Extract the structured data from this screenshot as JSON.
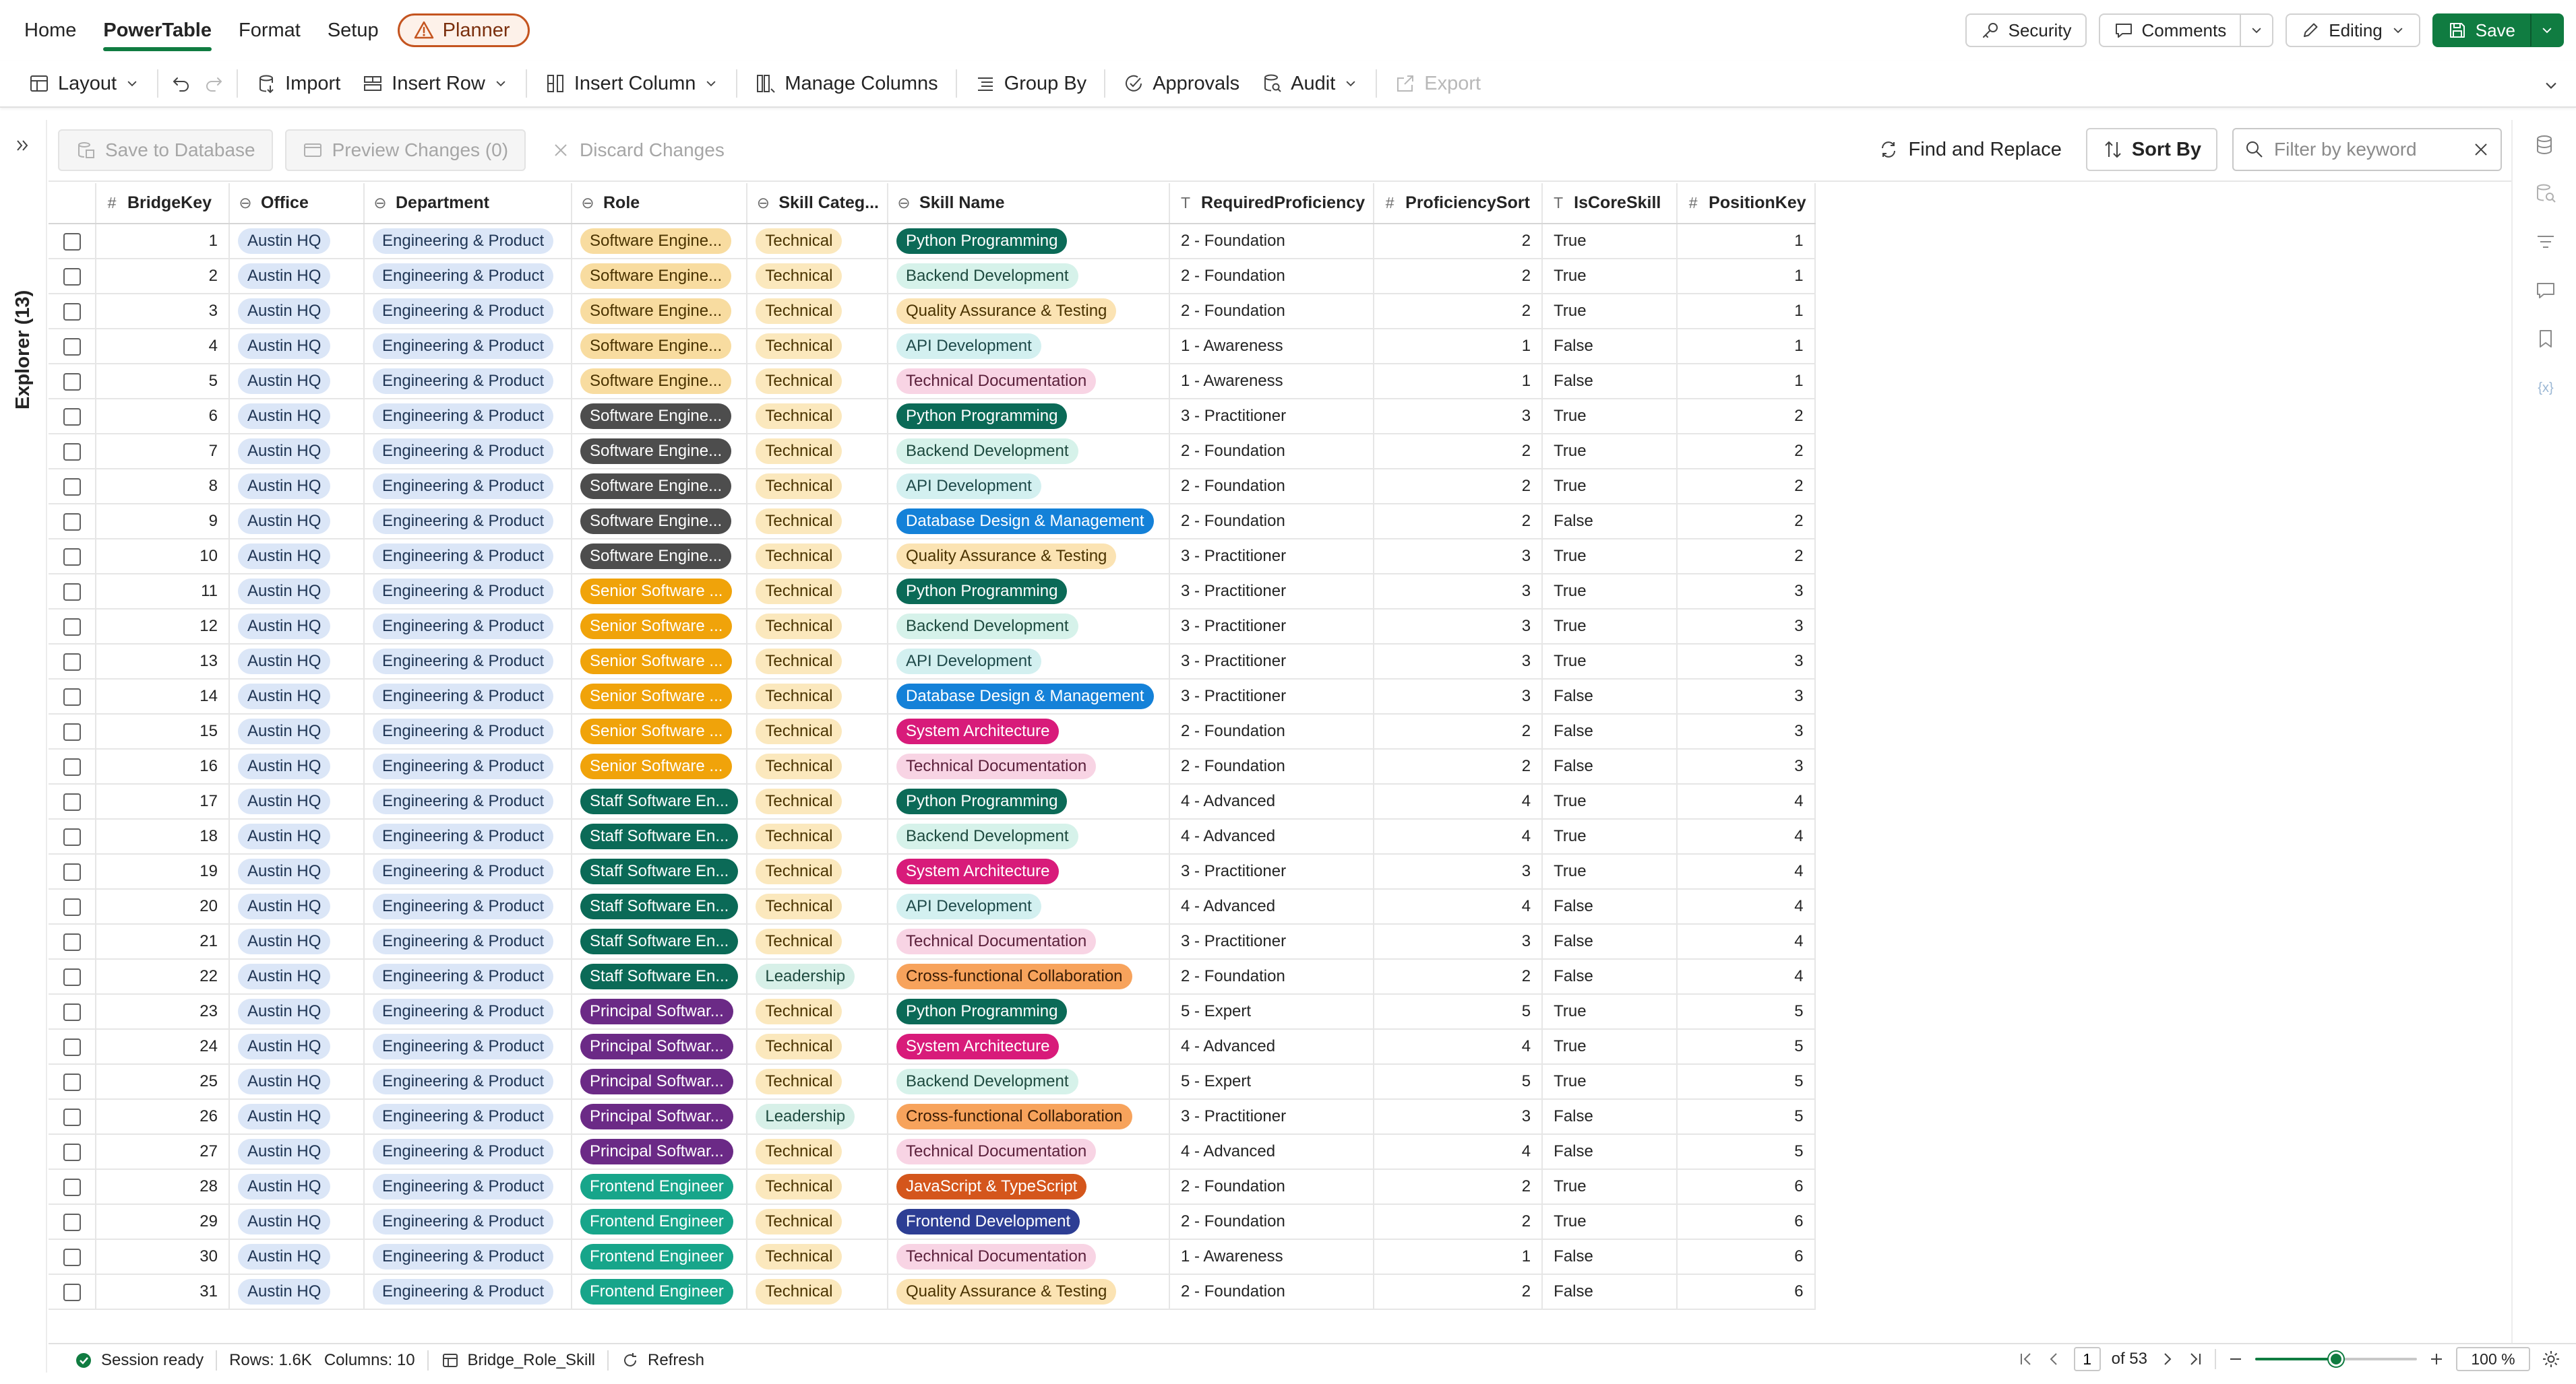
{
  "menu": {
    "tabs": [
      {
        "label": "Home",
        "active": false
      },
      {
        "label": "PowerTable",
        "active": true
      },
      {
        "label": "Format",
        "active": false
      },
      {
        "label": "Setup",
        "active": false
      }
    ],
    "planner_label": "Planner",
    "security_label": "Security",
    "comments_label": "Comments",
    "editing_label": "Editing",
    "save_label": "Save"
  },
  "ribbon": {
    "layout": "Layout",
    "import": "Import",
    "insert_row": "Insert Row",
    "insert_column": "Insert Column",
    "manage_columns": "Manage Columns",
    "group_by": "Group By",
    "approvals": "Approvals",
    "audit": "Audit",
    "export": "Export"
  },
  "explorer": {
    "label": "Explorer (13)"
  },
  "actions": {
    "save_db": "Save to Database",
    "preview": "Preview Changes (0)",
    "discard": "Discard Changes",
    "find_replace": "Find and Replace",
    "sort_by": "Sort By",
    "filter_placeholder": "Filter by keyword"
  },
  "colors": {
    "brand_green": "#107c41",
    "planner_border": "#c4541f"
  },
  "table": {
    "columns": [
      {
        "label": "BridgeKey",
        "icon": "#"
      },
      {
        "label": "Office",
        "icon": "⊖"
      },
      {
        "label": "Department",
        "icon": "⊖"
      },
      {
        "label": "Role",
        "icon": "⊖"
      },
      {
        "label": "Skill Categ...",
        "icon": "⊖"
      },
      {
        "label": "Skill Name",
        "icon": "⊖"
      },
      {
        "label": "RequiredProficiency",
        "icon": "T"
      },
      {
        "label": "ProficiencySort",
        "icon": "#"
      },
      {
        "label": "IsCoreSkill",
        "icon": "T"
      },
      {
        "label": "PositionKey",
        "icon": "#"
      }
    ],
    "role_styles": {
      "Software Engine...": {
        "bg": "#f8dca0",
        "fg": "#4a3300"
      },
      "Software Engine...|2": {
        "bg": "#4d4d4d",
        "fg": "#ffffff"
      },
      "Senior Software ...": {
        "bg": "#f0a30a",
        "fg": "#ffffff"
      },
      "Staff Software En...": {
        "bg": "#0b6a57",
        "fg": "#ffffff"
      },
      "Principal Softwar...": {
        "bg": "#6b2a86",
        "fg": "#ffffff"
      },
      "Frontend Engineer": {
        "bg": "#17a58a",
        "fg": "#ffffff"
      }
    },
    "category_styles": {
      "Technical": {
        "bg": "#fbe8bd",
        "fg": "#4a3300"
      },
      "Leadership": {
        "bg": "#d7f0e8",
        "fg": "#1e4a3f"
      }
    },
    "skill_styles": {
      "Python Programming": {
        "bg": "#0b6a57",
        "fg": "#ffffff"
      },
      "Backend Development": {
        "bg": "#d6f2ea",
        "fg": "#1e4a3f"
      },
      "Quality Assurance & Testing": {
        "bg": "#fbe3b3",
        "fg": "#4a3300"
      },
      "API Development": {
        "bg": "#d3f0f0",
        "fg": "#1f4a4a"
      },
      "Technical Documentation": {
        "bg": "#f8d4e4",
        "fg": "#5a1f3a"
      },
      "Database Design & Management": {
        "bg": "#1481d8",
        "fg": "#ffffff"
      },
      "System Architecture": {
        "bg": "#d81b7a",
        "fg": "#ffffff"
      },
      "Cross-functional Collaboration": {
        "bg": "#f7a35c",
        "fg": "#3b1d05"
      },
      "JavaScript & TypeScript": {
        "bg": "#d4561c",
        "fg": "#ffffff"
      },
      "Frontend Development": {
        "bg": "#2d3e94",
        "fg": "#ffffff"
      }
    },
    "rows": [
      {
        "key": "1",
        "office": "Austin HQ",
        "dept": "Engineering & Product",
        "role": "Software Engine...",
        "role_style": "Software Engine...",
        "cat": "Technical",
        "skill": "Python Programming",
        "prof": "2 - Foundation",
        "sort": "2",
        "core": "True",
        "pos": "1"
      },
      {
        "key": "2",
        "office": "Austin HQ",
        "dept": "Engineering & Product",
        "role": "Software Engine...",
        "role_style": "Software Engine...",
        "cat": "Technical",
        "skill": "Backend Development",
        "prof": "2 - Foundation",
        "sort": "2",
        "core": "True",
        "pos": "1"
      },
      {
        "key": "3",
        "office": "Austin HQ",
        "dept": "Engineering & Product",
        "role": "Software Engine...",
        "role_style": "Software Engine...",
        "cat": "Technical",
        "skill": "Quality Assurance & Testing",
        "prof": "2 - Foundation",
        "sort": "2",
        "core": "True",
        "pos": "1"
      },
      {
        "key": "4",
        "office": "Austin HQ",
        "dept": "Engineering & Product",
        "role": "Software Engine...",
        "role_style": "Software Engine...",
        "cat": "Technical",
        "skill": "API Development",
        "prof": "1 - Awareness",
        "sort": "1",
        "core": "False",
        "pos": "1"
      },
      {
        "key": "5",
        "office": "Austin HQ",
        "dept": "Engineering & Product",
        "role": "Software Engine...",
        "role_style": "Software Engine...",
        "cat": "Technical",
        "skill": "Technical Documentation",
        "prof": "1 - Awareness",
        "sort": "1",
        "core": "False",
        "pos": "1"
      },
      {
        "key": "6",
        "office": "Austin HQ",
        "dept": "Engineering & Product",
        "role": "Software Engine...",
        "role_style": "Software Engine...|2",
        "cat": "Technical",
        "skill": "Python Programming",
        "prof": "3 - Practitioner",
        "sort": "3",
        "core": "True",
        "pos": "2"
      },
      {
        "key": "7",
        "office": "Austin HQ",
        "dept": "Engineering & Product",
        "role": "Software Engine...",
        "role_style": "Software Engine...|2",
        "cat": "Technical",
        "skill": "Backend Development",
        "prof": "2 - Foundation",
        "sort": "2",
        "core": "True",
        "pos": "2"
      },
      {
        "key": "8",
        "office": "Austin HQ",
        "dept": "Engineering & Product",
        "role": "Software Engine...",
        "role_style": "Software Engine...|2",
        "cat": "Technical",
        "skill": "API Development",
        "prof": "2 - Foundation",
        "sort": "2",
        "core": "True",
        "pos": "2"
      },
      {
        "key": "9",
        "office": "Austin HQ",
        "dept": "Engineering & Product",
        "role": "Software Engine...",
        "role_style": "Software Engine...|2",
        "cat": "Technical",
        "skill": "Database Design & Management",
        "prof": "2 - Foundation",
        "sort": "2",
        "core": "False",
        "pos": "2"
      },
      {
        "key": "10",
        "office": "Austin HQ",
        "dept": "Engineering & Product",
        "role": "Software Engine...",
        "role_style": "Software Engine...|2",
        "cat": "Technical",
        "skill": "Quality Assurance & Testing",
        "prof": "3 - Practitioner",
        "sort": "3",
        "core": "True",
        "pos": "2"
      },
      {
        "key": "11",
        "office": "Austin HQ",
        "dept": "Engineering & Product",
        "role": "Senior Software ...",
        "role_style": "Senior Software ...",
        "cat": "Technical",
        "skill": "Python Programming",
        "prof": "3 - Practitioner",
        "sort": "3",
        "core": "True",
        "pos": "3"
      },
      {
        "key": "12",
        "office": "Austin HQ",
        "dept": "Engineering & Product",
        "role": "Senior Software ...",
        "role_style": "Senior Software ...",
        "cat": "Technical",
        "skill": "Backend Development",
        "prof": "3 - Practitioner",
        "sort": "3",
        "core": "True",
        "pos": "3"
      },
      {
        "key": "13",
        "office": "Austin HQ",
        "dept": "Engineering & Product",
        "role": "Senior Software ...",
        "role_style": "Senior Software ...",
        "cat": "Technical",
        "skill": "API Development",
        "prof": "3 - Practitioner",
        "sort": "3",
        "core": "True",
        "pos": "3"
      },
      {
        "key": "14",
        "office": "Austin HQ",
        "dept": "Engineering & Product",
        "role": "Senior Software ...",
        "role_style": "Senior Software ...",
        "cat": "Technical",
        "skill": "Database Design & Management",
        "prof": "3 - Practitioner",
        "sort": "3",
        "core": "False",
        "pos": "3"
      },
      {
        "key": "15",
        "office": "Austin HQ",
        "dept": "Engineering & Product",
        "role": "Senior Software ...",
        "role_style": "Senior Software ...",
        "cat": "Technical",
        "skill": "System Architecture",
        "prof": "2 - Foundation",
        "sort": "2",
        "core": "False",
        "pos": "3"
      },
      {
        "key": "16",
        "office": "Austin HQ",
        "dept": "Engineering & Product",
        "role": "Senior Software ...",
        "role_style": "Senior Software ...",
        "cat": "Technical",
        "skill": "Technical Documentation",
        "prof": "2 - Foundation",
        "sort": "2",
        "core": "False",
        "pos": "3"
      },
      {
        "key": "17",
        "office": "Austin HQ",
        "dept": "Engineering & Product",
        "role": "Staff Software En...",
        "role_style": "Staff Software En...",
        "cat": "Technical",
        "skill": "Python Programming",
        "prof": "4 - Advanced",
        "sort": "4",
        "core": "True",
        "pos": "4"
      },
      {
        "key": "18",
        "office": "Austin HQ",
        "dept": "Engineering & Product",
        "role": "Staff Software En...",
        "role_style": "Staff Software En...",
        "cat": "Technical",
        "skill": "Backend Development",
        "prof": "4 - Advanced",
        "sort": "4",
        "core": "True",
        "pos": "4"
      },
      {
        "key": "19",
        "office": "Austin HQ",
        "dept": "Engineering & Product",
        "role": "Staff Software En...",
        "role_style": "Staff Software En...",
        "cat": "Technical",
        "skill": "System Architecture",
        "prof": "3 - Practitioner",
        "sort": "3",
        "core": "True",
        "pos": "4"
      },
      {
        "key": "20",
        "office": "Austin HQ",
        "dept": "Engineering & Product",
        "role": "Staff Software En...",
        "role_style": "Staff Software En...",
        "cat": "Technical",
        "skill": "API Development",
        "prof": "4 - Advanced",
        "sort": "4",
        "core": "False",
        "pos": "4"
      },
      {
        "key": "21",
        "office": "Austin HQ",
        "dept": "Engineering & Product",
        "role": "Staff Software En...",
        "role_style": "Staff Software En...",
        "cat": "Technical",
        "skill": "Technical Documentation",
        "prof": "3 - Practitioner",
        "sort": "3",
        "core": "False",
        "pos": "4"
      },
      {
        "key": "22",
        "office": "Austin HQ",
        "dept": "Engineering & Product",
        "role": "Staff Software En...",
        "role_style": "Staff Software En...",
        "cat": "Leadership",
        "skill": "Cross-functional Collaboration",
        "prof": "2 - Foundation",
        "sort": "2",
        "core": "False",
        "pos": "4"
      },
      {
        "key": "23",
        "office": "Austin HQ",
        "dept": "Engineering & Product",
        "role": "Principal Softwar...",
        "role_style": "Principal Softwar...",
        "cat": "Technical",
        "skill": "Python Programming",
        "prof": "5 - Expert",
        "sort": "5",
        "core": "True",
        "pos": "5"
      },
      {
        "key": "24",
        "office": "Austin HQ",
        "dept": "Engineering & Product",
        "role": "Principal Softwar...",
        "role_style": "Principal Softwar...",
        "cat": "Technical",
        "skill": "System Architecture",
        "prof": "4 - Advanced",
        "sort": "4",
        "core": "True",
        "pos": "5"
      },
      {
        "key": "25",
        "office": "Austin HQ",
        "dept": "Engineering & Product",
        "role": "Principal Softwar...",
        "role_style": "Principal Softwar...",
        "cat": "Technical",
        "skill": "Backend Development",
        "prof": "5 - Expert",
        "sort": "5",
        "core": "True",
        "pos": "5"
      },
      {
        "key": "26",
        "office": "Austin HQ",
        "dept": "Engineering & Product",
        "role": "Principal Softwar...",
        "role_style": "Principal Softwar...",
        "cat": "Leadership",
        "skill": "Cross-functional Collaboration",
        "prof": "3 - Practitioner",
        "sort": "3",
        "core": "False",
        "pos": "5"
      },
      {
        "key": "27",
        "office": "Austin HQ",
        "dept": "Engineering & Product",
        "role": "Principal Softwar...",
        "role_style": "Principal Softwar...",
        "cat": "Technical",
        "skill": "Technical Documentation",
        "prof": "4 - Advanced",
        "sort": "4",
        "core": "False",
        "pos": "5"
      },
      {
        "key": "28",
        "office": "Austin HQ",
        "dept": "Engineering & Product",
        "role": "Frontend Engineer",
        "role_style": "Frontend Engineer",
        "cat": "Technical",
        "skill": "JavaScript & TypeScript",
        "prof": "2 - Foundation",
        "sort": "2",
        "core": "True",
        "pos": "6"
      },
      {
        "key": "29",
        "office": "Austin HQ",
        "dept": "Engineering & Product",
        "role": "Frontend Engineer",
        "role_style": "Frontend Engineer",
        "cat": "Technical",
        "skill": "Frontend Development",
        "prof": "2 - Foundation",
        "sort": "2",
        "core": "True",
        "pos": "6"
      },
      {
        "key": "30",
        "office": "Austin HQ",
        "dept": "Engineering & Product",
        "role": "Frontend Engineer",
        "role_style": "Frontend Engineer",
        "cat": "Technical",
        "skill": "Technical Documentation",
        "prof": "1 - Awareness",
        "sort": "1",
        "core": "False",
        "pos": "6"
      },
      {
        "key": "31",
        "office": "Austin HQ",
        "dept": "Engineering & Product",
        "role": "Frontend Engineer",
        "role_style": "Frontend Engineer",
        "cat": "Technical",
        "skill": "Quality Assurance & Testing",
        "prof": "2 - Foundation",
        "sort": "2",
        "core": "False",
        "pos": "6"
      }
    ]
  },
  "status": {
    "session": "Session ready",
    "rows": "Rows: 1.6K",
    "columns": "Columns: 10",
    "table_name": "Bridge_Role_Skill",
    "refresh": "Refresh",
    "page_current": "1",
    "page_total": "of 53",
    "zoom": "100 %",
    "zoom_level": 0.5
  }
}
